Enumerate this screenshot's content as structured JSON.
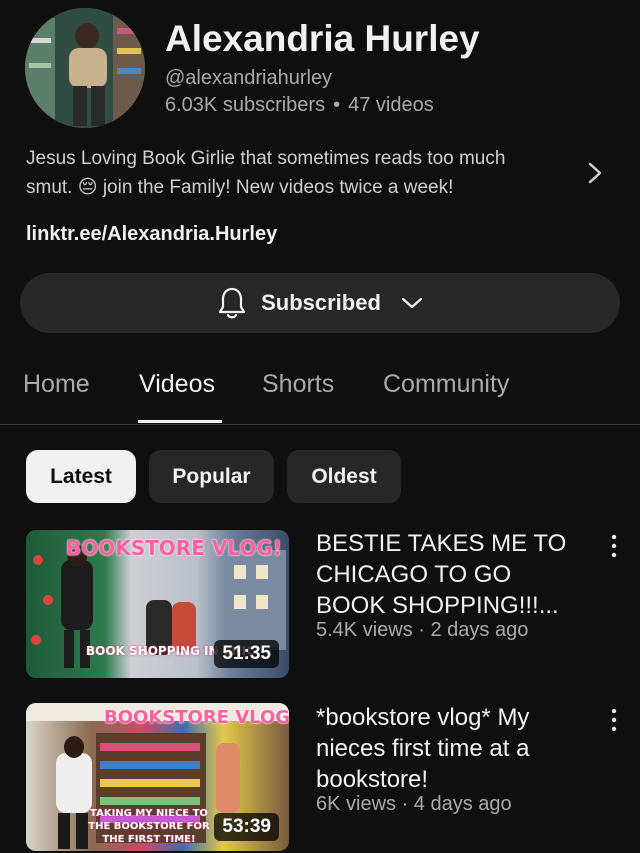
{
  "channel": {
    "name": "Alexandria Hurley",
    "handle": "@alexandriahurley",
    "subscribers": "6.03K subscribers",
    "separator": "•",
    "videos_count": "47 videos",
    "description_line1": "Jesus Loving Book Girlie that sometimes reads too much",
    "description_line2": "smut. 😔 join the Family! New videos twice a week!",
    "link": "linktr.ee/Alexandria.Hurley",
    "subscribe_label": "Subscribed"
  },
  "tabs": [
    {
      "label": "Home",
      "active": false
    },
    {
      "label": "Videos",
      "active": true
    },
    {
      "label": "Shorts",
      "active": false
    },
    {
      "label": "Community",
      "active": false
    }
  ],
  "filters": [
    {
      "label": "Latest",
      "selected": true
    },
    {
      "label": "Popular",
      "selected": false
    },
    {
      "label": "Oldest",
      "selected": false
    }
  ],
  "videos": [
    {
      "title": "BESTIE TAKES ME TO CHICAGO TO GO BOOK SHOPPING!!!...",
      "meta": "5.4K views · 2 days ago",
      "duration": "51:35",
      "thumb_title": "BOOKSTORE VLOG!",
      "thumb_sub": "BOOK SHOPPING IN CHIC"
    },
    {
      "title": "*bookstore vlog* My nieces first time at a bookstore!",
      "meta": "6K views · 4 days ago",
      "duration": "53:39",
      "thumb_title": "BOOKSTORE VLOG",
      "thumb_sub": "TAKING MY NIECE TO THE BOOKSTORE FOR THE FIRST TIME!"
    }
  ],
  "icons": {
    "bell": "bell-icon",
    "chevron_down": "chevron-down-icon",
    "chevron_right": "chevron-right-icon",
    "more": "more-vert-icon"
  }
}
